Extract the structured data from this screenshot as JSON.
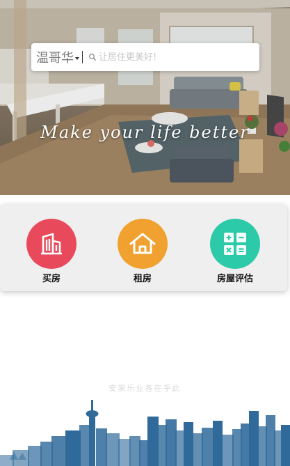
{
  "hero": {
    "tagline": "Make your life better"
  },
  "search": {
    "city": "温哥华",
    "placeholder": "让居住更美好!"
  },
  "categories": [
    {
      "label": "买房",
      "icon": "building-icon",
      "color": "#e84a5c"
    },
    {
      "label": "租房",
      "icon": "house-icon",
      "color": "#f0a12f"
    },
    {
      "label": "房屋评估",
      "icon": "calculator-icon",
      "color": "#2ccaa8"
    }
  ],
  "footer": {
    "slogan": "安家乐业各在乎此"
  },
  "colors": {
    "skyline": "#2f6a9a",
    "panel": "#efefef"
  }
}
